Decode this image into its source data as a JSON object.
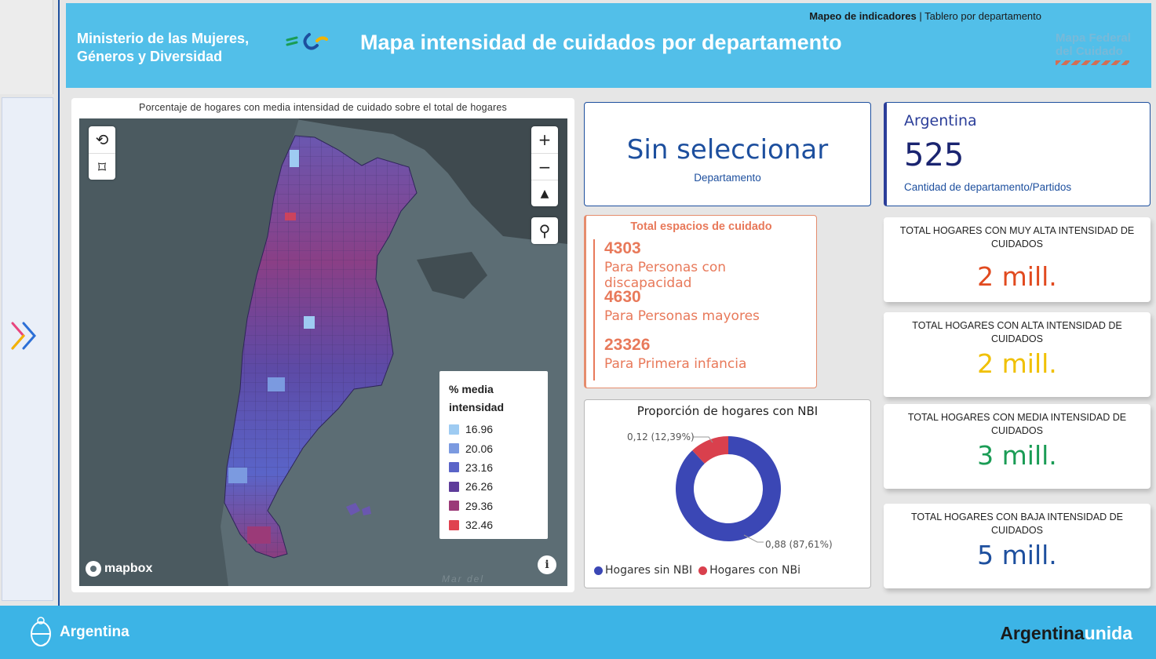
{
  "header": {
    "ministry_line1": "Ministerio de las Mujeres,",
    "ministry_line2": "Géneros y Diversidad",
    "title": "Mapa intensidad de cuidados por departamento",
    "breadcrumb_bold": "Mapeo de indicadores",
    "breadcrumb_sep": " | ",
    "breadcrumb_rest": "Tablero por departamento",
    "fed_logo_line1": "Mapa Federal",
    "fed_logo_line2": "del Cuidado"
  },
  "map": {
    "title": "Porcentaje de hogares con media intensidad de cuidado sobre el total de hogares",
    "attribution": "mapbox",
    "sea_label": "Mar del",
    "controls": {
      "zoom_in": "+",
      "zoom_out": "−",
      "compass": "▲",
      "search": "⚲",
      "lasso": "⟲",
      "select_box": "⌑",
      "info": "i"
    },
    "legend": {
      "title_line1": "% media",
      "title_line2": "intensidad",
      "items": [
        {
          "label": "16.96",
          "color": "#9ecbf2"
        },
        {
          "label": "20.06",
          "color": "#7b9ae0"
        },
        {
          "label": "23.16",
          "color": "#5a64c8"
        },
        {
          "label": "26.26",
          "color": "#5e3c9a"
        },
        {
          "label": "29.36",
          "color": "#9b3a78"
        },
        {
          "label": "32.46",
          "color": "#e0424f"
        }
      ]
    }
  },
  "selection_card": {
    "value": "Sin seleccionar",
    "label": "Departamento"
  },
  "argentina_card": {
    "name": "Argentina",
    "count": "525",
    "label": "Cantidad de departamento/Partidos"
  },
  "espacios": {
    "title": "Total espacios de cuidado",
    "items": [
      {
        "value": "4303",
        "label": "Para Personas con discapacidad"
      },
      {
        "value": "4630",
        "label": "Para Personas mayores"
      },
      {
        "value": "23326",
        "label": "Para Primera infancia"
      }
    ]
  },
  "nbi": {
    "title": "Proporción de hogares con NBI",
    "slices": [
      {
        "name": "Hogares sin NBI",
        "value": 0.88,
        "label": "0,88 (87,61%)",
        "color": "#3b47b5"
      },
      {
        "name": "Hogares con NBi",
        "value": 0.12,
        "label": "0,12 (12,39%)",
        "color": "#d9404d"
      }
    ]
  },
  "kpis": [
    {
      "title": "TOTAL HOGARES CON MUY ALTA INTENSIDAD DE CUIDADOS",
      "value": "2 mill.",
      "color": "#e14a1f"
    },
    {
      "title": "TOTAL HOGARES CON ALTA INTENSIDAD DE CUIDADOS",
      "value": "2 mill.",
      "color": "#f0c000"
    },
    {
      "title": "TOTAL HOGARES CON MEDIA INTENSIDAD DE CUIDADOS",
      "value": "3 mill.",
      "color": "#1a9c55"
    },
    {
      "title": "TOTAL HOGARES CON BAJA INTENSIDAD DE CUIDADOS",
      "value": "5 mill.",
      "color": "#1d4f9e"
    }
  ],
  "footer": {
    "left": "Argentina",
    "right_a": "Argentina",
    "right_b": "unida"
  }
}
